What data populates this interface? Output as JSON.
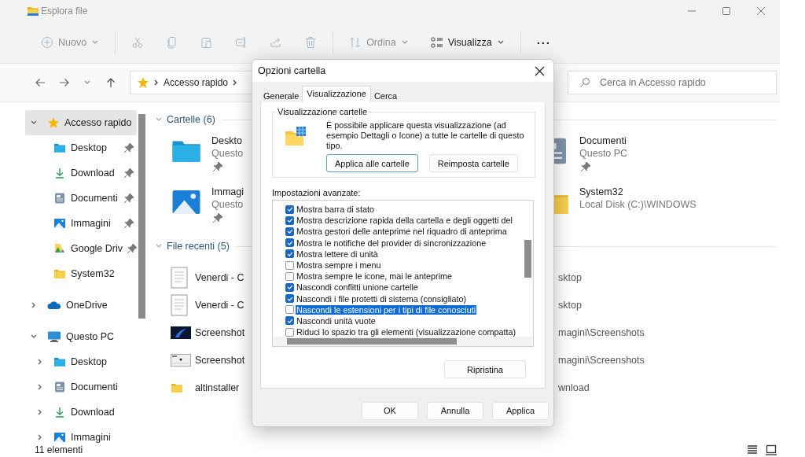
{
  "window": {
    "title": "Esplora file"
  },
  "toolbar": [
    {
      "kind": "new",
      "label": "Nuovo",
      "disabled": true
    },
    {
      "kind": "separator"
    },
    {
      "kind": "cut",
      "disabled": true
    },
    {
      "kind": "copy",
      "disabled": true
    },
    {
      "kind": "paste",
      "disabled": true
    },
    {
      "kind": "rename",
      "disabled": true
    },
    {
      "kind": "share",
      "disabled": true
    },
    {
      "kind": "delete",
      "disabled": true
    },
    {
      "kind": "separator"
    },
    {
      "kind": "sort",
      "label": "Ordina",
      "disabled": true
    },
    {
      "kind": "view",
      "label": "Visualizza",
      "disabled": false
    },
    {
      "kind": "separator"
    },
    {
      "kind": "more",
      "label": "···",
      "disabled": false
    }
  ],
  "address": {
    "path": [
      {
        "label": "Accesso rapido"
      }
    ]
  },
  "search": {
    "placeholder": "Cerca in Accesso rapido"
  },
  "sidebar": {
    "items": [
      {
        "label": "Accesso rapido",
        "kind": "star",
        "expanded": true,
        "selected": true,
        "children": [
          {
            "label": "Desktop",
            "kind": "desktop",
            "pinned": true,
            "selected": false
          },
          {
            "label": "Download",
            "kind": "download",
            "pinned": true,
            "selected": false
          },
          {
            "label": "Documenti",
            "kind": "documents",
            "pinned": true,
            "selected": false
          },
          {
            "label": "Immagini",
            "kind": "pictures",
            "pinned": true,
            "selected": false
          },
          {
            "label": "Google Driv",
            "kind": "drive",
            "pinned": true,
            "selected": false
          },
          {
            "label": "System32",
            "kind": "folder",
            "pinned": false,
            "selected": false
          }
        ]
      },
      {
        "label": "OneDrive",
        "kind": "cloud",
        "expanded": false,
        "selected": false
      },
      {
        "label": "Questo PC",
        "kind": "pc",
        "expanded": true,
        "selected": false,
        "children": [
          {
            "label": "Desktop",
            "kind": "desktop",
            "expanded": false,
            "selected": false
          },
          {
            "label": "Documenti",
            "kind": "documents",
            "expanded": false,
            "selected": false
          },
          {
            "label": "Download",
            "kind": "download",
            "expanded": false,
            "selected": false
          },
          {
            "label": "Immagini",
            "kind": "pictures",
            "expanded": false,
            "selected": false
          }
        ]
      }
    ]
  },
  "folders": {
    "heading": "Cartelle (6)",
    "expanded": true,
    "items": [
      {
        "kind": "desktop",
        "name": "Deskto",
        "location": "Questo",
        "pinned": true
      },
      {
        "kind": "documents",
        "name": "Documenti",
        "location": "Questo PC",
        "pinned": true
      },
      {
        "kind": "pictures",
        "name": "Immagi",
        "location": "Questo",
        "pinned": true
      },
      {
        "kind": "folder",
        "name": "System32",
        "location": "Local Disk (C:)\\WINDOWS",
        "pinned": false
      }
    ]
  },
  "recent": {
    "heading": "File recenti (5)",
    "expanded": true,
    "items": [
      {
        "kind": "document",
        "name": "Venerdi - C",
        "path": "sktop"
      },
      {
        "kind": "document",
        "name": "Venerdi - C",
        "path": "sktop"
      },
      {
        "kind": "shot-dark",
        "name": "Screenshot",
        "path": "magini\\Screenshots"
      },
      {
        "kind": "shot-light",
        "name": "Screenshot",
        "path": "magini\\Screenshots"
      },
      {
        "kind": "folder",
        "name": "altinstaller",
        "path": "wnload"
      }
    ]
  },
  "status_bar": {
    "count": "11 elementi"
  },
  "dialog": {
    "title": "Opzioni cartella",
    "tabs": [
      {
        "label": "Generale",
        "selected": false
      },
      {
        "label": "Visualizzazione",
        "selected": true
      },
      {
        "label": "Cerca",
        "selected": false
      }
    ],
    "group": {
      "title": "Visualizzazione cartelle",
      "text": "È possibile applicare questa visualizzazione (ad esempio Dettagli o Icone) a tutte le cartelle di questo tipo.",
      "buttons": [
        {
          "label": "Applica alle cartelle",
          "focused": true
        },
        {
          "label": "Reimposta cartelle",
          "focused": false
        }
      ]
    },
    "advanced_label": "Impostazioni avanzate:",
    "settings": [
      {
        "label": "Mostra barra di stato",
        "checked": true,
        "selected": false
      },
      {
        "label": "Mostra descrizione rapida della cartella e degli oggetti del",
        "checked": true,
        "selected": false
      },
      {
        "label": "Mostra gestori delle anteprime nel riquadro di anteprima",
        "checked": true,
        "selected": false
      },
      {
        "label": "Mostra le notifiche del provider di sincronizzazione",
        "checked": true,
        "selected": false
      },
      {
        "label": "Mostra lettere di unità",
        "checked": true,
        "selected": false
      },
      {
        "label": "Mostra sempre i menu",
        "checked": false,
        "selected": false
      },
      {
        "label": "Mostra sempre le icone, mai le anteprime",
        "checked": false,
        "selected": false
      },
      {
        "label": "Nascondi conflitti unione cartelle",
        "checked": true,
        "selected": false
      },
      {
        "label": "Nascondi i file protetti di sistema (consigliato)",
        "checked": true,
        "selected": false
      },
      {
        "label": "Nascondi le estensioni per i tipi di file conosciuti",
        "checked": false,
        "selected": true
      },
      {
        "label": "Nascondi unità vuote",
        "checked": true,
        "selected": false
      },
      {
        "label": "Riduci lo spazio tra gli elementi (visualizzazione compatta)",
        "checked": false,
        "selected": false
      }
    ],
    "restore_button": "Ripristina",
    "buttons": [
      "OK",
      "Annulla",
      "Applica"
    ]
  }
}
